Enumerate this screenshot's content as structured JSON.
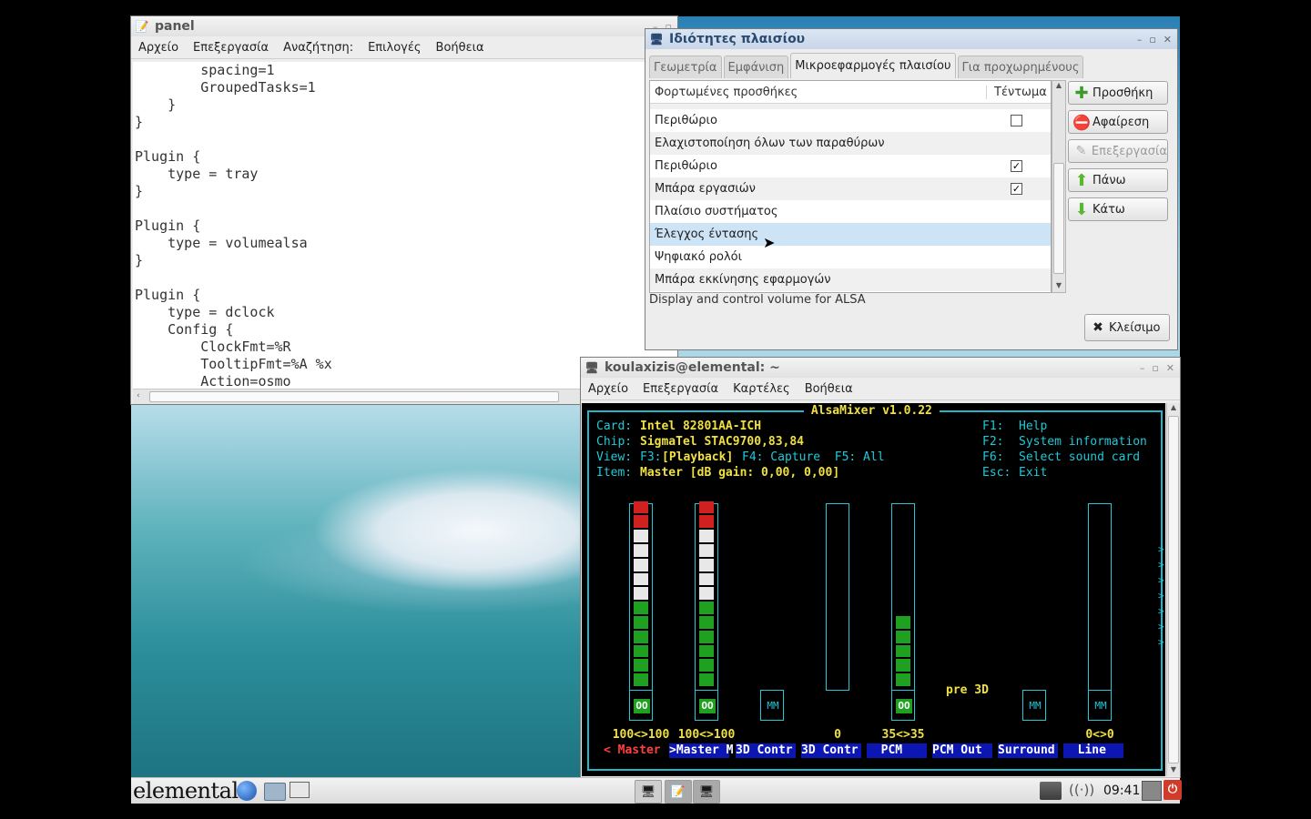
{
  "editor": {
    "title": "panel",
    "menu": [
      "Αρχείο",
      "Επεξεργασία",
      "Αναζήτηση:",
      "Επιλογές",
      "Βοήθεια"
    ],
    "lines": [
      "        spacing=1",
      "        GroupedTasks=1",
      "    }",
      "}",
      "",
      "Plugin {",
      "    type = tray",
      "}",
      "",
      "Plugin {",
      "    type = volumealsa",
      "}",
      "",
      "Plugin {",
      "    type = dclock",
      "    Config {",
      "        ClockFmt=%R",
      "        TooltipFmt=%A %x",
      "        Action=osmo"
    ]
  },
  "props": {
    "title": "Ιδιότητες πλαισίου",
    "tabs": [
      "Γεωμετρία",
      "Εμφάνιση",
      "Μικροεφαρμογές πλαισίου",
      "Για προχωρημένους"
    ],
    "selected_tab": 2,
    "col_loaded": "Φορτωμένες προσθήκες",
    "col_stretch": "Τέντωμα",
    "rows": [
      {
        "name": "Περιθώριο",
        "checkbox": true,
        "checked": false
      },
      {
        "name": "Ελαχιστοποίηση όλων των παραθύρων",
        "checkbox": false,
        "checked": false
      },
      {
        "name": "Περιθώριο",
        "checkbox": true,
        "checked": true
      },
      {
        "name": "Μπάρα εργασιών",
        "checkbox": true,
        "checked": true
      },
      {
        "name": "Πλαίσιο συστήματος",
        "checkbox": false,
        "checked": false
      },
      {
        "name": "Έλεγχος έντασης",
        "checkbox": false,
        "checked": false,
        "selected": true
      },
      {
        "name": "Ψηφιακό ρολόι",
        "checkbox": false,
        "checked": false
      },
      {
        "name": "Μπάρα εκκίνησης εφαρμογών",
        "checkbox": false,
        "checked": false
      }
    ],
    "description": "Display and control volume for ALSA",
    "buttons": {
      "add": "Προσθήκη",
      "remove": "Αφαίρεση",
      "edit": "Επεξεργασία",
      "up": "Πάνω",
      "down": "Κάτω",
      "close": "Κλείσιμο"
    },
    "check_glyph": "✓"
  },
  "terminal": {
    "title": "koulaxizis@elemental: ~",
    "menu": [
      "Αρχείο",
      "Επεξεργασία",
      "Καρτέλες",
      "Βοήθεια"
    ],
    "alsamixer": {
      "header": " AlsaMixer v1.0.22 ",
      "card_label": "Card:",
      "card": "Intel 82801AA-ICH",
      "chip_label": "Chip:",
      "chip": "SigmaTel STAC9700,83,84",
      "view_label": "View:",
      "view_f3": "F3:",
      "view_playback": "[Playback]",
      "view_rest": "F4: Capture  F5: All",
      "item_label": "Item:",
      "item": "Master [dB gain: 0,00, 0,00]",
      "help": [
        {
          "key": "F1:",
          "text": "Help"
        },
        {
          "key": "F2:",
          "text": "System information"
        },
        {
          "key": "F6:",
          "text": "Select sound card"
        },
        {
          "key": "Esc:",
          "text": "Exit"
        }
      ],
      "pre3d": "pre 3D",
      "channels": [
        {
          "name": "< Master ",
          "value_text": "100<>100",
          "level": 100,
          "mute": "OO",
          "type": "vol"
        },
        {
          "name": ">Master M",
          "value_text": "100<>100",
          "level": 100,
          "mute": "OO",
          "type": "vol"
        },
        {
          "name": "3D Contr",
          "value_text": "",
          "level": null,
          "mute": "MM",
          "type": "switch"
        },
        {
          "name": "3D Contr",
          "value_text": "0",
          "level": 0,
          "mute": "",
          "type": "vol"
        },
        {
          "name": "  PCM   ",
          "value_text": "35<>35",
          "level": 35,
          "mute": "OO",
          "type": "vol"
        },
        {
          "name": "PCM Out ",
          "value_text": "",
          "level": null,
          "mute": "",
          "type": "none"
        },
        {
          "name": "Surround",
          "value_text": "",
          "level": null,
          "mute": "MM",
          "type": "switch"
        },
        {
          "name": "  Line  ",
          "value_text": "0<>0",
          "level": 0,
          "mute": "MM",
          "type": "vol"
        }
      ],
      "more_arrows": ">"
    }
  },
  "taskbar": {
    "logo": "elemental",
    "clock": "09:41"
  },
  "colors": {
    "alsa_cyan": "#20c8d8",
    "alsa_yellow": "#f0e040",
    "alsa_green": "#20a020",
    "alsa_red": "#d02020",
    "selection": "#cde4f7"
  }
}
